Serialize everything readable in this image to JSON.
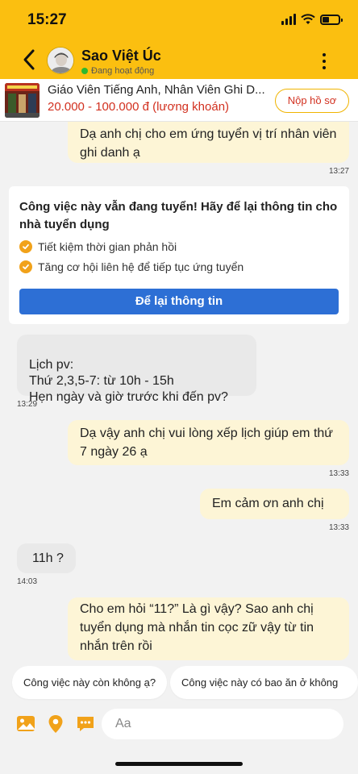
{
  "status_bar": {
    "time": "15:27"
  },
  "header": {
    "shop_name": "Sao Việt Úc",
    "online_status": "Đang hoạt động",
    "brand_color": "#fbbf10"
  },
  "job": {
    "title": "Giáo Viên Tiếng Anh, Nhân Viên Ghi D...",
    "salary": "20.000 - 100.000 đ (lương khoán)",
    "apply_label": "Nộp hồ sơ"
  },
  "messages": [
    {
      "sender": "me",
      "text": "Dạ anh chị cho em ứng tuyển vị trí nhân viên ghi danh ạ",
      "time": "13:27"
    },
    {
      "sender": "them",
      "text": "Lịch pv:\nThứ 2,3,5-7: từ 10h - 15h\nHẹn ngày và giờ trước khi đến pv?",
      "time": "13:29"
    },
    {
      "sender": "me",
      "text": "Dạ vậy anh chị vui lòng xếp lịch giúp em thứ 7 ngày 26 ạ",
      "time": "13:33"
    },
    {
      "sender": "me",
      "text": "Em cảm ơn anh chị",
      "time": "13:33"
    },
    {
      "sender": "them",
      "text": "11h ?",
      "time": "14:03"
    },
    {
      "sender": "me",
      "text": "Cho em hỏi “11?” Là gì vậy? Sao anh chị tuyển dụng mà nhắn tin cọc zữ vậy từ tin nhắn trên rồi",
      "time": ""
    }
  ],
  "notice": {
    "title": "Công việc này vẫn đang tuyển! Hãy để lại thông tin cho nhà tuyển dụng",
    "items": [
      "Tiết kiệm thời gian phản hồi",
      "Tăng cơ hội liên hệ để tiếp tục ứng tuyển"
    ],
    "button_label": "Để lại thông tin",
    "button_color": "#2d6fd5"
  },
  "suggestions": [
    "Công việc này còn không ạ?",
    "Công việc này có bao ăn ở không ạ?"
  ],
  "input": {
    "placeholder": "Aa"
  },
  "icons": [
    "back-arrow-icon",
    "more-vertical-icon",
    "image-icon",
    "location-pin-icon",
    "chat-bubble-icon",
    "check-circle-icon"
  ]
}
